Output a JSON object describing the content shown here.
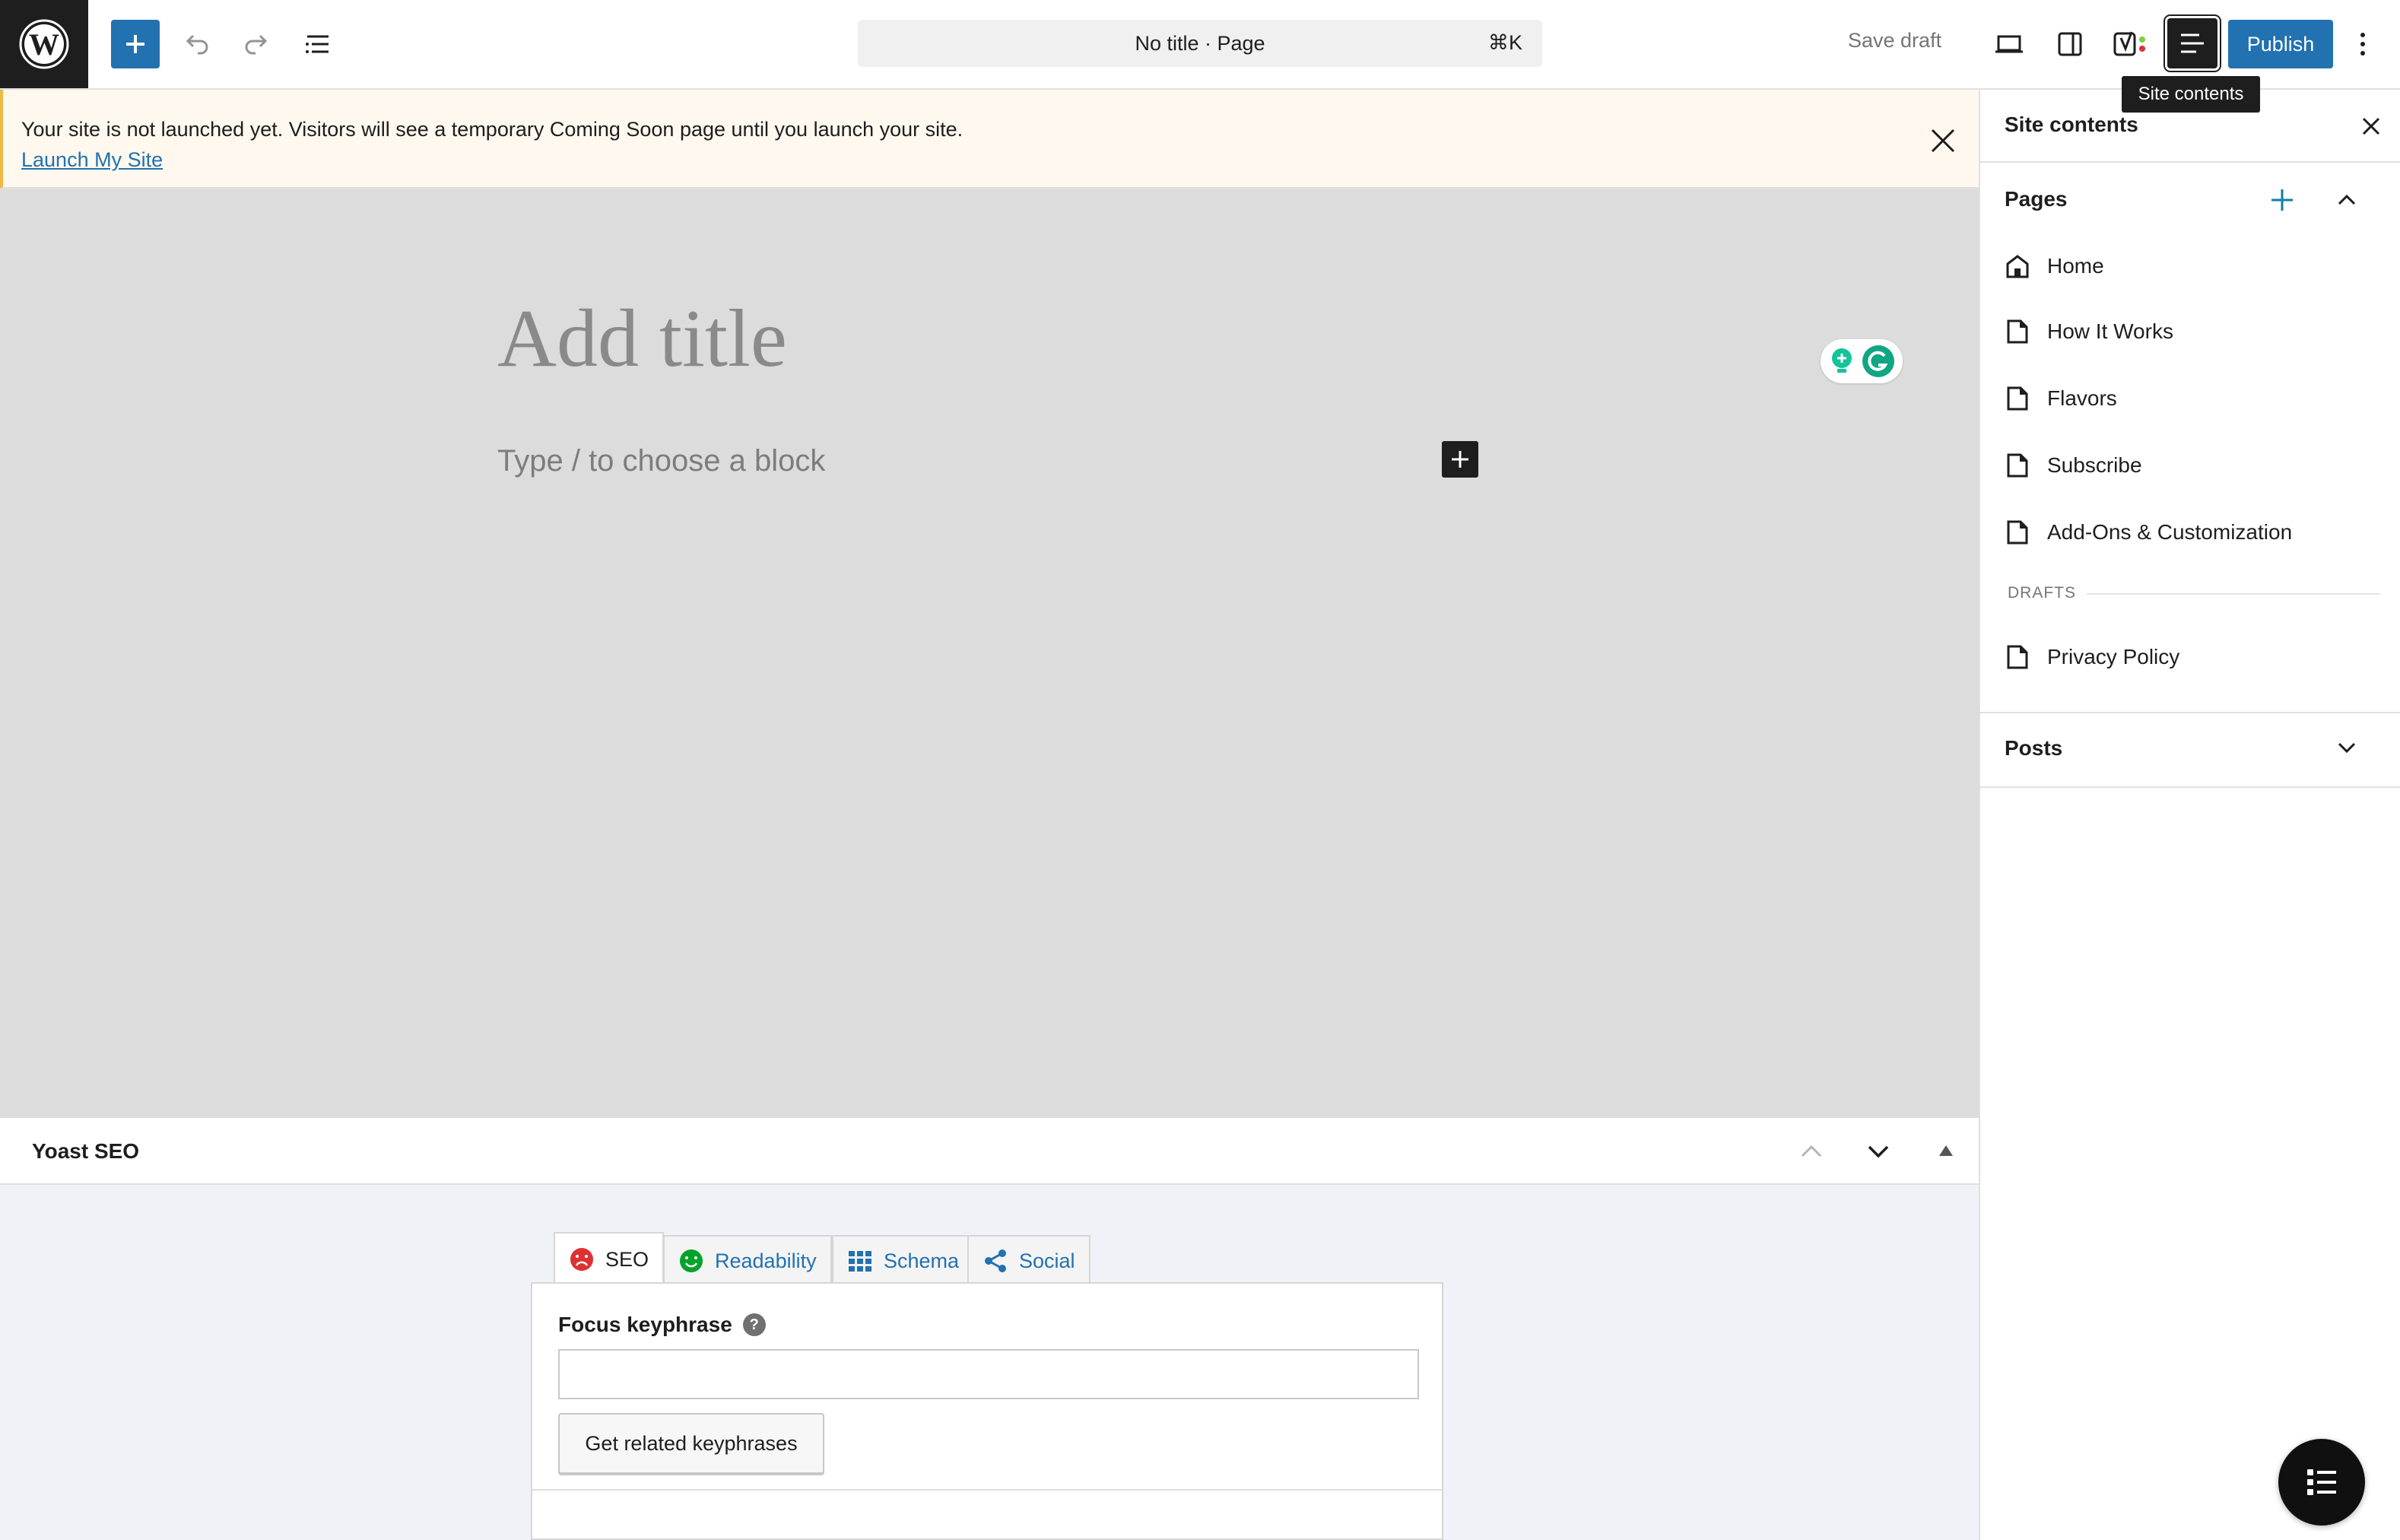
{
  "toolbar": {
    "document_title": "No title · Page",
    "shortcut": "⌘K",
    "save_draft": "Save draft",
    "publish": "Publish",
    "tooltip": "Site contents"
  },
  "notice": {
    "message": "Your site is not launched yet. Visitors will see a temporary Coming Soon page until you launch your site.",
    "link": "Launch My Site"
  },
  "editor": {
    "title_placeholder": "Add title",
    "block_placeholder": "Type / to choose a block"
  },
  "yoast": {
    "title": "Yoast SEO",
    "tabs": [
      {
        "label": "SEO"
      },
      {
        "label": "Readability"
      },
      {
        "label": "Schema"
      },
      {
        "label": "Social"
      }
    ],
    "focus_label": "Focus keyphrase",
    "focus_value": "",
    "related_button": "Get related keyphrases"
  },
  "sidebar": {
    "title": "Site contents",
    "pages_title": "Pages",
    "pages": [
      {
        "label": "Home",
        "icon": "home-icon"
      },
      {
        "label": "How It Works",
        "icon": "page-icon"
      },
      {
        "label": "Flavors",
        "icon": "page-icon"
      },
      {
        "label": "Subscribe",
        "icon": "page-icon"
      },
      {
        "label": "Add-Ons & Customization",
        "icon": "page-icon"
      }
    ],
    "drafts_label": "DRAFTS",
    "drafts": [
      {
        "label": "Privacy Policy",
        "icon": "page-icon"
      }
    ],
    "posts_title": "Posts"
  },
  "colors": {
    "accent": "#2271b1",
    "dark": "#1e1e1e",
    "notice_bg": "#fef8ee",
    "seo_bad": "#dc3232",
    "readability_good": "#00a32a"
  }
}
